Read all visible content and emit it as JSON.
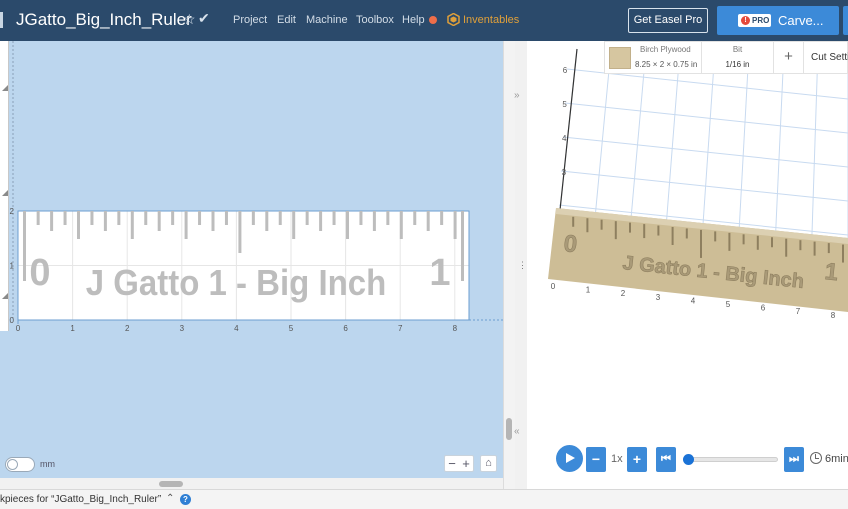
{
  "app": {
    "project_title": "JGatto_Big_Inch_Ruler",
    "menu": [
      "Project",
      "Edit",
      "Machine",
      "Toolbox",
      "Help"
    ],
    "inventables": "Inventables",
    "get_easel_pro": "Get Easel Pro",
    "pro_badge": "PRO",
    "pro_badge_alert": "!",
    "carve": "Carve...",
    "star_glyph": "☆",
    "check_glyph": "✔",
    "colors": {
      "topbar": "#2b4a6b",
      "accent": "#3c8ad8",
      "canvas": "#bcd6ee",
      "help_dot": "#ee6e4a",
      "inventables": "#e0a03a"
    }
  },
  "design": {
    "x_ticks": [
      "0",
      "1",
      "2",
      "3",
      "4",
      "5",
      "6",
      "7",
      "8"
    ],
    "y_ticks": [
      "2",
      "1",
      "0"
    ],
    "ruler_text": "J Gatto 1 - Big Inch",
    "ruler_zero": "0",
    "ruler_one": "1",
    "units_label": "mm",
    "zoom_minus": "−",
    "zoom_plus": "+",
    "home_glyph": "⌂"
  },
  "dividers": {
    "collapse_right": "»",
    "drag": "⋮",
    "collapse_left": "«"
  },
  "preview": {
    "material_name": "Birch Plywood",
    "material_dims": "8.25 × 2 × 0.75 in",
    "bit_label": "Bit",
    "bit_value": "1/16 in",
    "add_glyph": "+",
    "cut_settings": "Cut Settings",
    "y_ticks": [
      "6",
      "5",
      "4",
      "3"
    ],
    "x_ticks": [
      "0",
      "1",
      "2",
      "3",
      "4",
      "5",
      "6",
      "7",
      "8"
    ],
    "board_text": "J Gatto 1 - Big Inch",
    "board_zero": "0",
    "board_one": "1"
  },
  "playback": {
    "minus": "−",
    "speed": "1x",
    "plus": "+",
    "rewind_glyph": "⏮",
    "forward_glyph": "⏭",
    "progress": 0.0,
    "time": "6min"
  },
  "status": {
    "workpieces": "kpieces for “JGatto_Big_Inch_Ruler”",
    "chevron": "⌃",
    "help": "?"
  }
}
